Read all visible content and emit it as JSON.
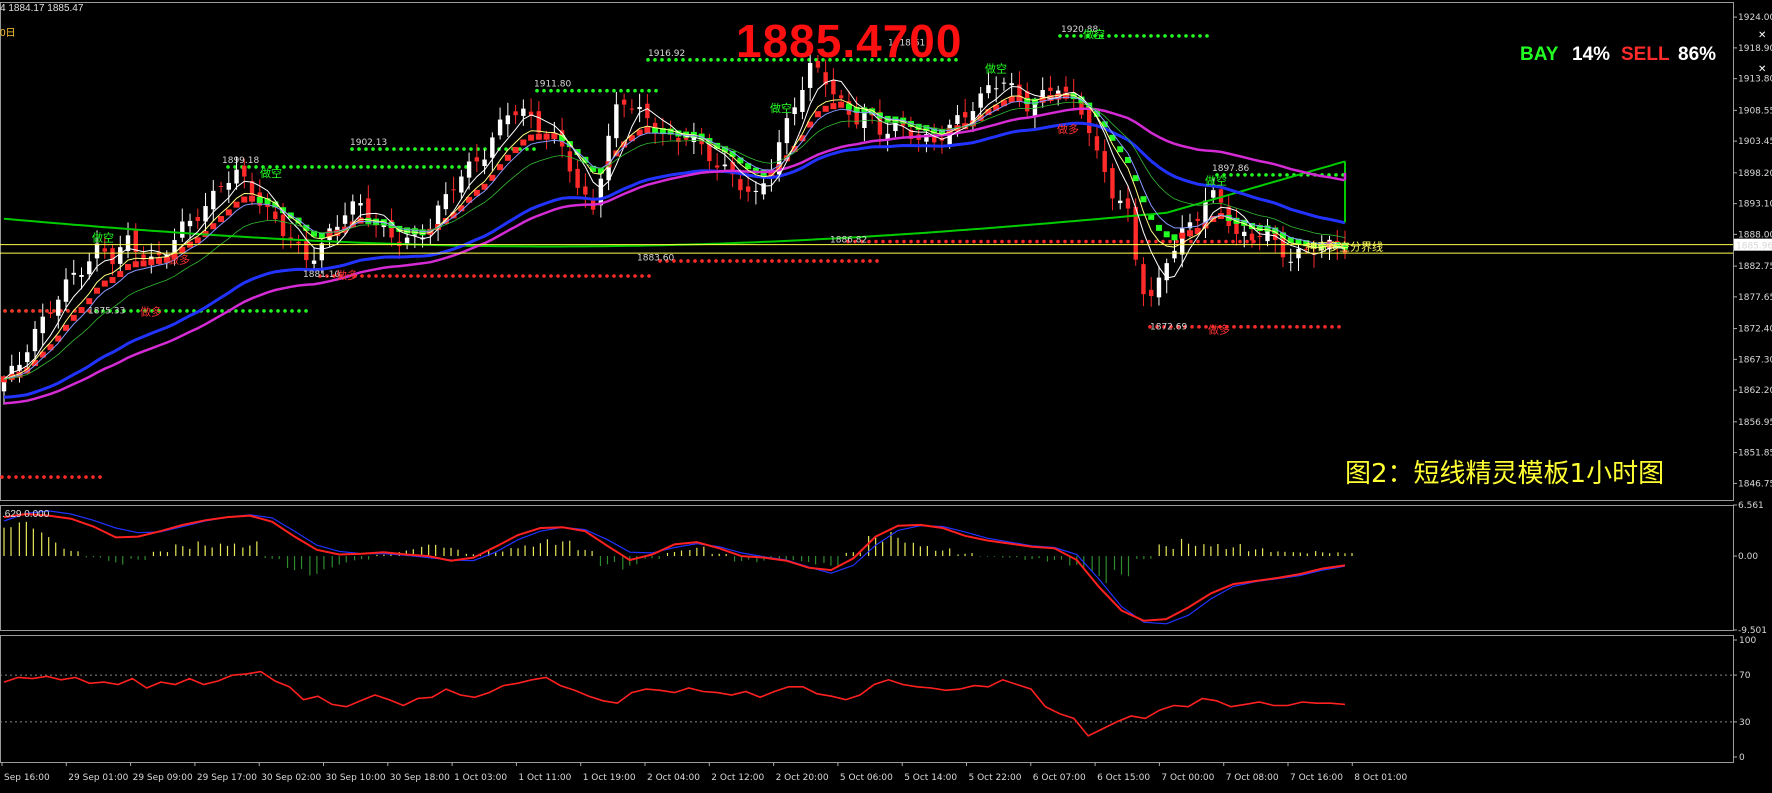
{
  "header": {
    "ohlc_text": "4 1884.17 1885.47",
    "period_text": "0日"
  },
  "banner": {
    "price": "1885.4700"
  },
  "signal": {
    "bay_label": "BAY",
    "bay_value": "14%",
    "sell_label": "SELL",
    "sell_value": "86%"
  },
  "caption": "图2：短线精灵模板1小时图",
  "osc_header": ".629 0.000",
  "colors": {
    "up": "#ffffff",
    "down": "#ff2a2a",
    "green_signal": "#22ff22",
    "red_signal": "#ff2a2a",
    "ma_slow": "#00cc00",
    "ma_blue": "#2233ff",
    "ma_magenta": "#d42bd4",
    "current_line": "#ffff44"
  },
  "chart_data": [
    {
      "type": "candlestick",
      "title": "",
      "ylim": [
        1844.0,
        1926.5
      ],
      "y_ticks": [
        "1924.00",
        "1918.90",
        "1913.80",
        "1908.55",
        "1903.45",
        "1898.20",
        "1893.10",
        "1888.00",
        "1882.75",
        "1877.65",
        "1872.40",
        "1867.30",
        "1862.20",
        "1856.95",
        "1851.85",
        "1846.75"
      ],
      "current_price_label": "1885.96",
      "x_ticks": [
        "Sep 16:00",
        "29 Sep 01:00",
        "29 Sep 09:00",
        "29 Sep 17:00",
        "30 Sep 02:00",
        "30 Sep 10:00",
        "30 Sep 18:00",
        "1 Oct 03:00",
        "1 Oct 11:00",
        "1 Oct 19:00",
        "2 Oct 04:00",
        "2 Oct 12:00",
        "2 Oct 20:00",
        "5 Oct 06:00",
        "5 Oct 14:00",
        "5 Oct 22:00",
        "6 Oct 07:00",
        "6 Oct 15:00",
        "7 Oct 00:00",
        "7 Oct 08:00",
        "7 Oct 16:00",
        "8 Oct 01:00"
      ],
      "price_labels": [
        "1899.18",
        "1875.33",
        "1902.13",
        "1881.10",
        "1911.80",
        "1916.92",
        "1883.60",
        "1918.61",
        "1886.82",
        "1920.88",
        "1897.86",
        "1872.69"
      ],
      "text_annotations": [
        "做空",
        "做多",
        "神奇多空分界线"
      ],
      "close_path": [
        1864,
        1866,
        1871,
        1874,
        1878,
        1881,
        1883,
        1886,
        1884,
        1887,
        1885,
        1883,
        1886,
        1889,
        1891,
        1893,
        1897,
        1898,
        1896,
        1892,
        1890,
        1887,
        1884,
        1885,
        1889,
        1892,
        1893,
        1890,
        1888,
        1887,
        1887,
        1889,
        1893,
        1897,
        1899,
        1901,
        1905,
        1909,
        1908,
        1906,
        1904,
        1902,
        1895,
        1892,
        1902,
        1911,
        1909,
        1907,
        1905,
        1903,
        1905,
        1902,
        1900,
        1898,
        1896,
        1894,
        1899,
        1905,
        1911,
        1916,
        1914,
        1910,
        1907,
        1908,
        1905,
        1906,
        1905,
        1904,
        1903,
        1906,
        1907,
        1910,
        1912,
        1914,
        1911,
        1909,
        1911,
        1913,
        1910,
        1908,
        1900,
        1895,
        1893,
        1880,
        1877,
        1884,
        1888,
        1890,
        1895,
        1893,
        1888,
        1887,
        1889,
        1886,
        1884,
        1885,
        1886,
        1886,
        1886
      ]
    },
    {
      "type": "line",
      "title": "",
      "ylim": [
        -9.501,
        6.561
      ],
      "y_ticks": [
        "6.561",
        "0.00",
        "-9.501"
      ],
      "series": [
        {
          "values": [
            5,
            5.4,
            5.2,
            4.8,
            3.8,
            2.4,
            2.5,
            3.2,
            4,
            4.6,
            5,
            5.2,
            4.4,
            2.5,
            0.8,
            0.2,
            0.3,
            0.5,
            0.2,
            0,
            -0.6,
            -0.2,
            1.2,
            2.7,
            3.6,
            3.7,
            3.2,
            1.3,
            -0.5,
            0.2,
            1.5,
            1.8,
            1,
            0,
            -0.2,
            -0.6,
            -1.5,
            -1.8,
            -0.3,
            2.5,
            3.9,
            4,
            3.6,
            2.6,
            2,
            1.6,
            1.2,
            1,
            -0.5,
            -4,
            -7,
            -8.3,
            -8.1,
            -6.6,
            -4.8,
            -3.6,
            -3.2,
            -2.8,
            -2.3,
            -1.6,
            -1.2
          ]
        },
        {
          "values": [
            4.5,
            5.5,
            5.8,
            5.4,
            4.6,
            3.6,
            3,
            3.1,
            3.8,
            4.5,
            5,
            5.3,
            4.9,
            3.2,
            1.4,
            0.6,
            0.3,
            0.3,
            0.1,
            -0.2,
            -0.5,
            -0.6,
            0.5,
            2.1,
            3.2,
            3.7,
            3.4,
            2.1,
            0.5,
            0.4,
            1.1,
            1.6,
            1.2,
            0.4,
            -0.1,
            -0.5,
            -1.4,
            -2.2,
            -1.2,
            1.4,
            3.3,
            3.9,
            3.8,
            3.1,
            2.3,
            1.8,
            1.3,
            1.1,
            0.2,
            -3,
            -6.5,
            -8.5,
            -8.7,
            -7.6,
            -5.5,
            -3.9,
            -3.3,
            -2.9,
            -2.5,
            -1.8,
            -1.3
          ]
        }
      ],
      "histogram": [
        3.8,
        4.5,
        3.1,
        1.2,
        -0.3,
        -1.2,
        -0.5,
        0.6,
        1.5,
        2.2,
        2.6,
        2.2,
        -0.4,
        -1.8,
        -2.5,
        -1.6,
        -0.8,
        0.3,
        0.9,
        1.5,
        1.1,
        0.3,
        1.1,
        1.9,
        2.3,
        2,
        0.8,
        -1.3,
        -2.1,
        -0.6,
        0.8,
        1.2,
        0.3,
        -0.7,
        -0.9,
        -0.9,
        -1.3,
        -1.5,
        0.5,
        2.6,
        3.3,
        2.4,
        1.3,
        0.4,
        -0.1,
        -0.2,
        -0.5,
        -0.9,
        -2.2,
        -3.8,
        -2.6,
        -0.4,
        1.5,
        2.6,
        2.5,
        1.8,
        1,
        0.6,
        0.5,
        0.7,
        0.7
      ]
    },
    {
      "type": "line",
      "title": "",
      "ylim": [
        0,
        100
      ],
      "y_ticks": [
        "100",
        "70",
        "30",
        "0"
      ],
      "series": [
        {
          "values": [
            64,
            68,
            67,
            69,
            66,
            68,
            63,
            64,
            62,
            67,
            59,
            64,
            62,
            67,
            62,
            65,
            70,
            71,
            73,
            65,
            60,
            49,
            52,
            45,
            43,
            48,
            53,
            49,
            44,
            50,
            51,
            58,
            53,
            51,
            55,
            61,
            63,
            66,
            68,
            61,
            57,
            52,
            48,
            46,
            55,
            58,
            57,
            55,
            59,
            56,
            55,
            53,
            56,
            51,
            56,
            60,
            60,
            54,
            52,
            49,
            53,
            62,
            66,
            62,
            60,
            59,
            57,
            58,
            61,
            60,
            66,
            62,
            58,
            43,
            37,
            33,
            18,
            24,
            30,
            35,
            33,
            40,
            44,
            43,
            50,
            48,
            43,
            45,
            47,
            44,
            44,
            47,
            46,
            46,
            45
          ]
        }
      ]
    }
  ]
}
